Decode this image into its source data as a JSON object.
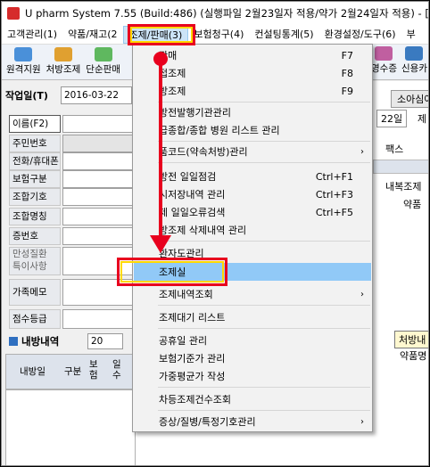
{
  "window": {
    "title": "U pharm System 7.55 (Build:486) (실행파일 2월23일자 적용/약가 2월24일자 적용) - [처방조"
  },
  "menubar": {
    "items": [
      "고객관리(1)",
      "약품/재고(2",
      "조제/판매(3)",
      "보험청구(4)",
      "컨설팅통계(5)",
      "환경설정/도구(6)",
      "부"
    ]
  },
  "toolbar": {
    "buttons": [
      "원격지원",
      "처방조제",
      "단순판매"
    ],
    "right_buttons": [
      "영수증",
      "신용카"
    ]
  },
  "left_panel": {
    "work_date_label": "작업일(T)",
    "work_date_value": "2016-03-22",
    "fields": [
      "이름(F2)",
      "주민번호",
      "전화/휴대폰",
      "보험구분",
      "조합기호",
      "조합명칭",
      "증번호",
      "만성질환\n특이사항",
      "가족메모",
      "점수등급"
    ],
    "rx_history_label": "내방내역",
    "rx_count": "20",
    "table_headers": [
      "내방일",
      "구분",
      "보험",
      "일수"
    ]
  },
  "right_bg": {
    "sodamsim": "소아심야",
    "day": "22일",
    "jae": "제",
    "fax": "팩스",
    "naebok": "내복조제",
    "yakpum": "약품",
    "cheobang_nae": "처방내",
    "yakpum_myeong": "약품명"
  },
  "dropdown": {
    "items": [
      {
        "label": "판매",
        "shortcut": "F7",
        "arrow": ""
      },
      {
        "label": "접조제",
        "shortcut": "F8",
        "arrow": ""
      },
      {
        "label": "방조제",
        "shortcut": "F9",
        "arrow": ""
      },
      {
        "label": "방전발행기관관리",
        "shortcut": "",
        "arrow": ""
      },
      {
        "label": "급종합/종합 병원 리스트 관리",
        "shortcut": "",
        "arrow": ""
      },
      {
        "label": "품코드(약속처방)관리",
        "shortcut": "",
        "arrow": "›"
      },
      {
        "label": "방전 일일점검",
        "shortcut": "Ctrl+F1",
        "arrow": ""
      },
      {
        "label": "시저장내역 관리",
        "shortcut": "Ctrl+F3",
        "arrow": ""
      },
      {
        "label": "제 일일오류검색",
        "shortcut": "Ctrl+F5",
        "arrow": ""
      },
      {
        "label": "방조제 삭제내역 관리",
        "shortcut": "",
        "arrow": ""
      },
      {
        "label": "환자도관리",
        "shortcut": "",
        "arrow": ""
      },
      {
        "label": "조제실",
        "shortcut": "",
        "arrow": ""
      },
      {
        "label": "조제내역조회",
        "shortcut": "",
        "arrow": "›"
      },
      {
        "label": "조제대기 리스트",
        "shortcut": "",
        "arrow": ""
      },
      {
        "label": "공휴일 관리",
        "shortcut": "",
        "arrow": ""
      },
      {
        "label": "보험기준가 관리",
        "shortcut": "",
        "arrow": ""
      },
      {
        "label": "가중평균가 작성",
        "shortcut": "",
        "arrow": ""
      },
      {
        "label": "차등조제건수조회",
        "shortcut": "",
        "arrow": ""
      },
      {
        "label": "증상/질병/특정기호관리",
        "shortcut": "",
        "arrow": "›"
      }
    ]
  },
  "colors": {
    "annotation_red": "#e8001e",
    "annotation_yellow": "#ffd800",
    "highlight": "#91c9f7"
  }
}
